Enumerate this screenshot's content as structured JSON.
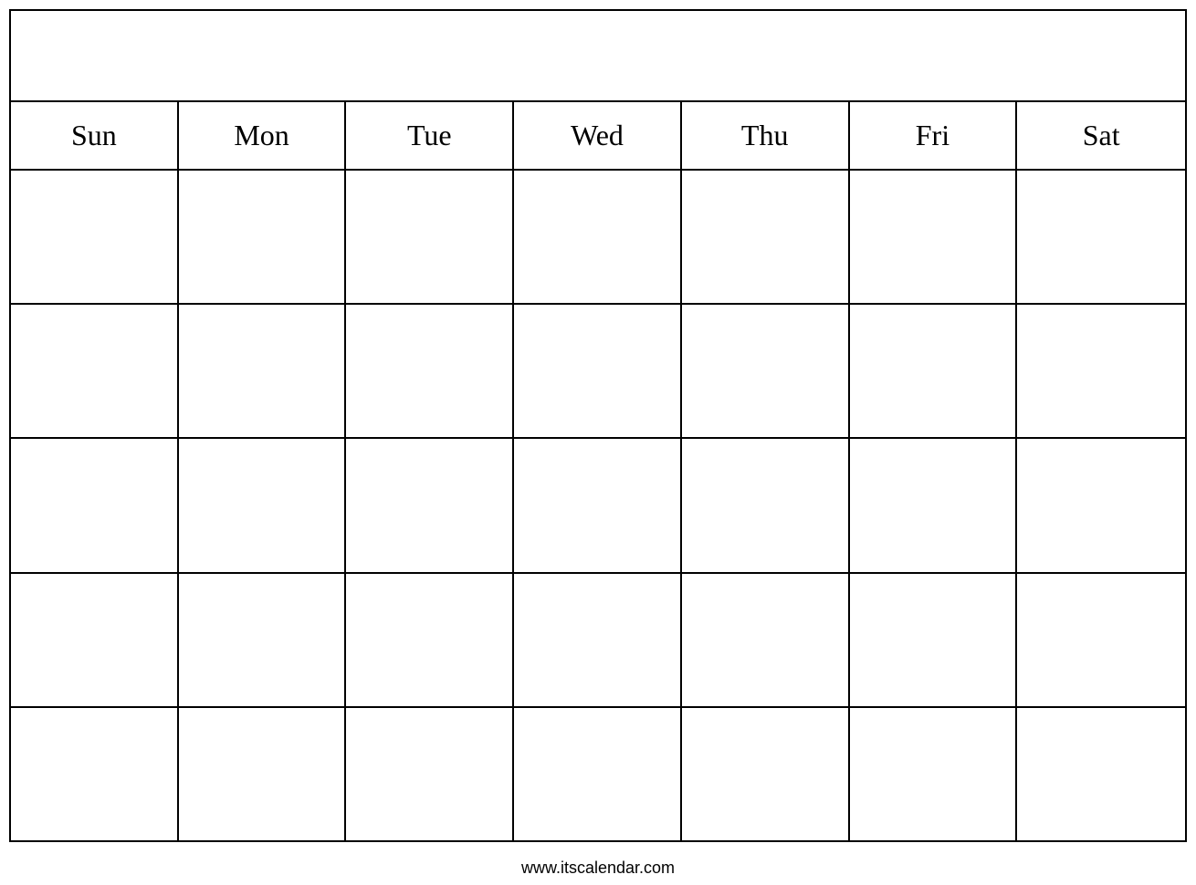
{
  "calendar": {
    "header": {
      "title": ""
    },
    "days": [
      {
        "label": "Sun"
      },
      {
        "label": "Mon"
      },
      {
        "label": "Tue"
      },
      {
        "label": "Wed"
      },
      {
        "label": "Thu"
      },
      {
        "label": "Fri"
      },
      {
        "label": "Sat"
      }
    ],
    "weeks": [
      [
        "",
        "",
        "",
        "",
        "",
        "",
        ""
      ],
      [
        "",
        "",
        "",
        "",
        "",
        "",
        ""
      ],
      [
        "",
        "",
        "",
        "",
        "",
        "",
        ""
      ],
      [
        "",
        "",
        "",
        "",
        "",
        "",
        ""
      ],
      [
        "",
        "",
        "",
        "",
        "",
        "",
        ""
      ]
    ]
  },
  "footer": {
    "url": "www.itscalendar.com"
  }
}
